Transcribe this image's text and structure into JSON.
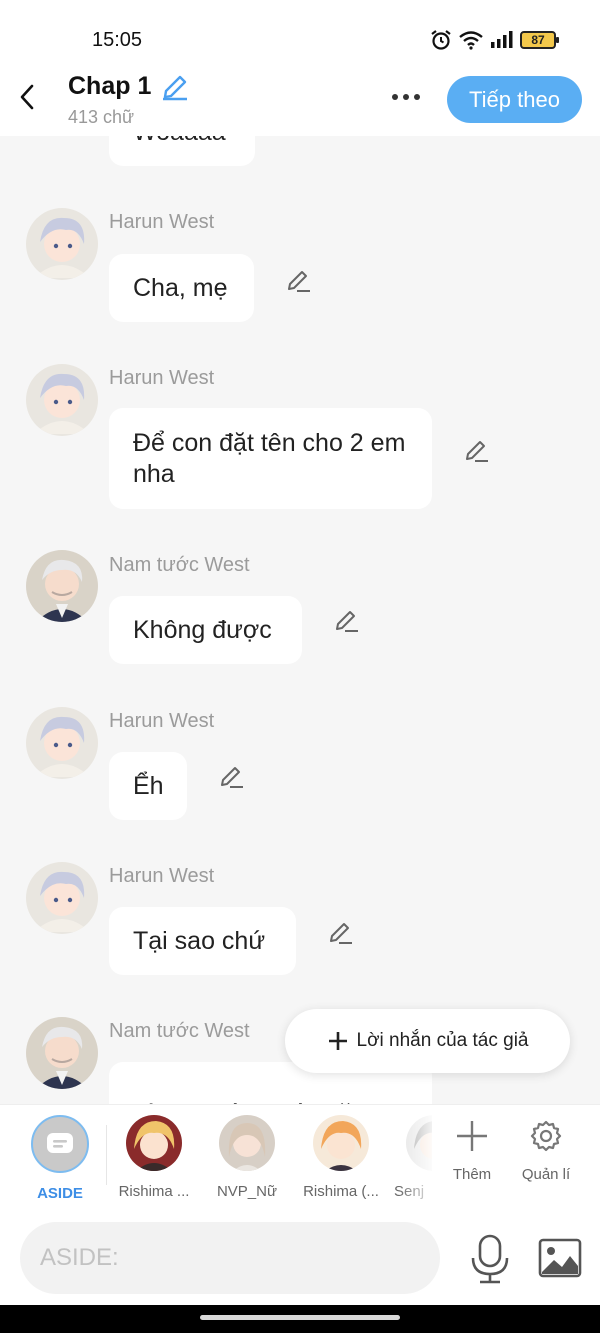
{
  "status_bar": {
    "time": "15:05",
    "battery": "87"
  },
  "header": {
    "title": "Chap 1",
    "word_count": "413 chữ",
    "next_label": "Tiếp theo"
  },
  "messages": [
    {
      "sender": "",
      "text": "Woaaaa"
    },
    {
      "sender": "Harun West",
      "text": "Cha, mẹ"
    },
    {
      "sender": "Harun West",
      "text": "Để con đặt tên cho 2 em nha"
    },
    {
      "sender": "Nam tước West",
      "text": "Không được"
    },
    {
      "sender": "Harun West",
      "text": "Ểh"
    },
    {
      "sender": "Harun West",
      "text": "Tại sao chứ"
    },
    {
      "sender": "Nam tước West",
      "text": "Vì ta sẽ là người đặt"
    }
  ],
  "author_note": {
    "label": "Lời nhắn của tác giả"
  },
  "characters": [
    {
      "label": "ASIDE"
    },
    {
      "label": "Rishima ..."
    },
    {
      "label": "NVP_Nữ"
    },
    {
      "label": "Rishima (..."
    },
    {
      "label": "Senj"
    }
  ],
  "tools": {
    "add_label": "Thêm",
    "manage_label": "Quản lí"
  },
  "input": {
    "placeholder": "ASIDE:"
  },
  "colors": {
    "accent": "#5aaef3",
    "aside_label": "#3d8ee6",
    "background": "#f6f6f6"
  }
}
